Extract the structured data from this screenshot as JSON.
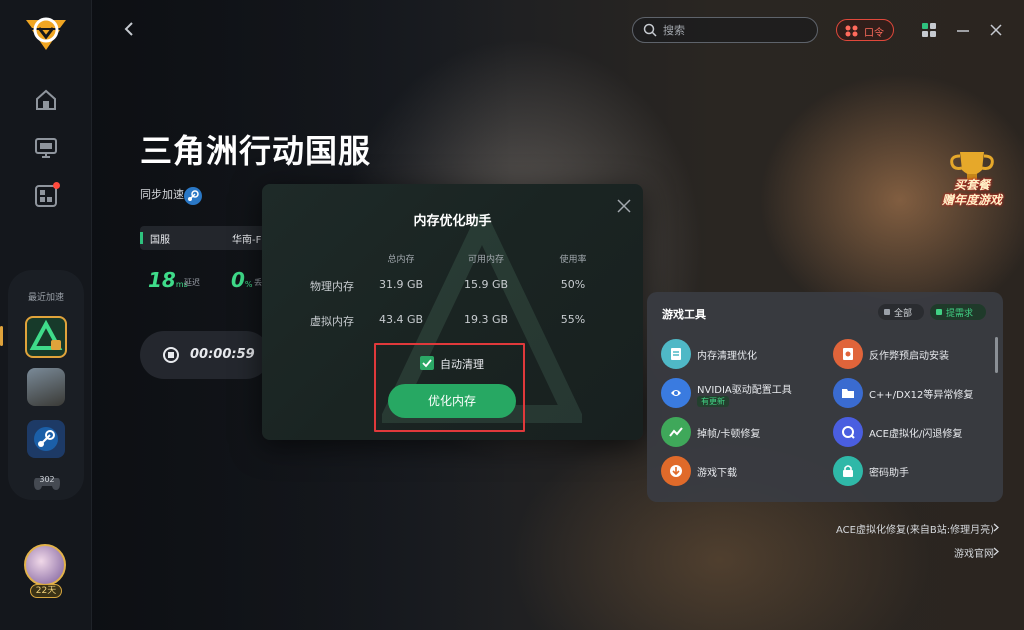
{
  "search": {
    "placeholder": "搜索"
  },
  "top_bar": {
    "command_label": "口令"
  },
  "sidebar": {
    "recent_label": "最近加速",
    "controller_count": "302",
    "avatar_days": "22天"
  },
  "game": {
    "title": "三角洲行动国服",
    "sync_label": "同步加速",
    "server_name": "国服",
    "server_region": "华南-F",
    "latency_value": "18",
    "latency_unit": "ms",
    "latency_label": "延迟",
    "loss_value": "0",
    "loss_unit": "%",
    "loss_label": "丢",
    "timer": "00:00:59"
  },
  "promo": {
    "line1": "买套餐",
    "line2": "赠年度游戏"
  },
  "modal": {
    "title": "内存优化助手",
    "columns": [
      "总内存",
      "可用内存",
      "使用率"
    ],
    "rows": [
      {
        "label": "物理内存",
        "total": "31.9 GB",
        "available": "15.9 GB",
        "usage": "50%"
      },
      {
        "label": "虚拟内存",
        "total": "43.4 GB",
        "available": "19.3 GB",
        "usage": "55%"
      }
    ],
    "auto_clean_label": "自动清理",
    "auto_clean_checked": true,
    "optimize_button": "优化内存"
  },
  "tools": {
    "title": "游戏工具",
    "all_label": "全部",
    "request_label": "提需求",
    "items": [
      {
        "label": "内存清理优化",
        "icon": "memory-clean-icon",
        "color": "#4fb8c6"
      },
      {
        "label": "反作弊预启动安装",
        "icon": "anticheat-icon",
        "color": "#e0643a"
      },
      {
        "label": "NVIDIA驱动配置工具",
        "icon": "nvidia-icon",
        "color": "#3a7be0",
        "badge": "有更新"
      },
      {
        "label": "C++/DX12等异常修复",
        "icon": "folder-repair-icon",
        "color": "#3a6bd0"
      },
      {
        "label": "掉帧/卡顿修复",
        "icon": "fps-repair-icon",
        "color": "#3fa85a"
      },
      {
        "label": "ACE虚拟化/闪退修复",
        "icon": "ace-repair-icon",
        "color": "#4a5ee0"
      },
      {
        "label": "游戏下载",
        "icon": "download-icon",
        "color": "#e06a2a"
      },
      {
        "label": "密码助手",
        "icon": "password-icon",
        "color": "#2fb8a8"
      }
    ]
  },
  "links": {
    "ace_fix": "ACE虚拟化修复(来自B站:修理月亮)",
    "official_site": "游戏官网"
  },
  "colors": {
    "accent_green": "#27a863",
    "highlight_red": "#e0393b",
    "gold": "#e0a33b"
  }
}
